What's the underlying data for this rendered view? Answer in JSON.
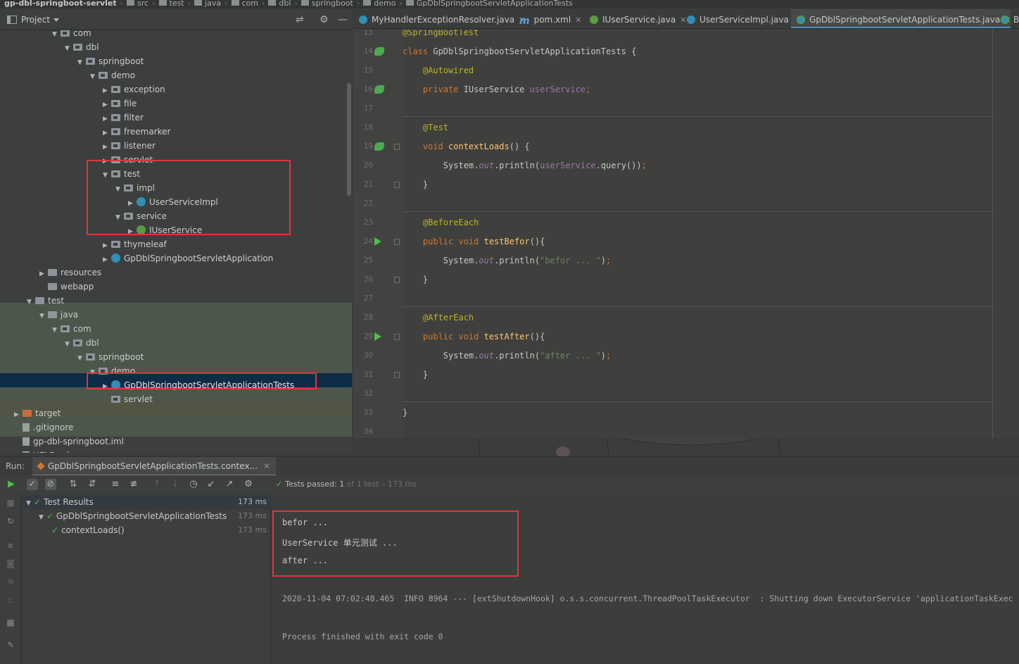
{
  "breadcrumb": [
    "gp-dbl-springboot-servlet",
    "src",
    "test",
    "java",
    "com",
    "dbl",
    "springboot",
    "demo",
    "GpDblSpringbootServletApplicationTests"
  ],
  "project_panel": {
    "title": "Project",
    "icons": [
      "collapse-icon",
      "gear-icon",
      "minimize-icon"
    ]
  },
  "tree": [
    {
      "label": "com",
      "depth": 5,
      "kind": "pkg",
      "arrow": "down"
    },
    {
      "label": "dbl",
      "depth": 6,
      "kind": "pkg",
      "arrow": "down"
    },
    {
      "label": "springboot",
      "depth": 7,
      "kind": "pkg",
      "arrow": "down"
    },
    {
      "label": "demo",
      "depth": 8,
      "kind": "pkg",
      "arrow": "down"
    },
    {
      "label": "exception",
      "depth": 9,
      "kind": "pkg",
      "arrow": "right"
    },
    {
      "label": "file",
      "depth": 9,
      "kind": "pkg",
      "arrow": "right"
    },
    {
      "label": "filter",
      "depth": 9,
      "kind": "pkg",
      "arrow": "right"
    },
    {
      "label": "freemarker",
      "depth": 9,
      "kind": "pkg",
      "arrow": "right"
    },
    {
      "label": "listener",
      "depth": 9,
      "kind": "pkg",
      "arrow": "right"
    },
    {
      "label": "servlet",
      "depth": 9,
      "kind": "pkg",
      "arrow": "right"
    },
    {
      "label": "test",
      "depth": 9,
      "kind": "pkg",
      "arrow": "down"
    },
    {
      "label": "impl",
      "depth": 10,
      "kind": "pkg",
      "arrow": "down"
    },
    {
      "label": "UserServiceImpl",
      "depth": 11,
      "kind": "class",
      "arrow": "right"
    },
    {
      "label": "service",
      "depth": 10,
      "kind": "pkg",
      "arrow": "down"
    },
    {
      "label": "IUserService",
      "depth": 11,
      "kind": "iface",
      "arrow": "right"
    },
    {
      "label": "thymeleaf",
      "depth": 9,
      "kind": "pkg",
      "arrow": "right"
    },
    {
      "label": "GpDblSpringbootServletApplication",
      "depth": 9,
      "kind": "class",
      "arrow": "right"
    },
    {
      "label": "resources",
      "depth": 4,
      "kind": "folder",
      "arrow": "right"
    },
    {
      "label": "webapp",
      "depth": 4,
      "kind": "folder",
      "arrow": ""
    },
    {
      "label": "test",
      "depth": 3,
      "kind": "folder",
      "arrow": "down"
    },
    {
      "label": "java",
      "depth": 4,
      "kind": "folder",
      "arrow": "down"
    },
    {
      "label": "com",
      "depth": 5,
      "kind": "pkg",
      "arrow": "down"
    },
    {
      "label": "dbl",
      "depth": 6,
      "kind": "pkg",
      "arrow": "down"
    },
    {
      "label": "springboot",
      "depth": 7,
      "kind": "pkg",
      "arrow": "down"
    },
    {
      "label": "demo",
      "depth": 8,
      "kind": "pkg",
      "arrow": "down"
    },
    {
      "label": "GpDblSpringbootServletApplicationTests",
      "depth": 9,
      "kind": "class",
      "arrow": "right"
    },
    {
      "label": "servlet",
      "depth": 9,
      "kind": "pkg",
      "arrow": ""
    },
    {
      "label": "target",
      "depth": 2,
      "kind": "orange",
      "arrow": "right"
    },
    {
      "label": ".gitignore",
      "depth": 2,
      "kind": "file",
      "arrow": ""
    },
    {
      "label": "gp-dbl-springboot.iml",
      "depth": 2,
      "kind": "file",
      "arrow": ""
    },
    {
      "label": "HELP.md",
      "depth": 2,
      "kind": "file",
      "arrow": ""
    }
  ],
  "editor_tabs": [
    {
      "label": "MyHandlerExceptionResolver.java",
      "icon": "class"
    },
    {
      "label": "pom.xml",
      "icon": "maven"
    },
    {
      "label": "IUserService.java",
      "icon": "iface"
    },
    {
      "label": "UserServiceImpl.java",
      "icon": "class"
    },
    {
      "label": "GpDblSpringbootServletApplicationTests.java",
      "icon": "test",
      "active": true
    },
    {
      "label": "Be",
      "icon": "test"
    }
  ],
  "code": [
    {
      "n": "13",
      "tokens": [
        [
          "ann",
          "@SpringBootTest"
        ]
      ]
    },
    {
      "n": "14",
      "tokens": [
        [
          "kw",
          "class "
        ],
        [
          "",
          "GpDblSpringbootServletApplicationTests {"
        ]
      ]
    },
    {
      "n": "15",
      "tokens": [
        [
          "",
          "    "
        ],
        [
          "ann",
          "@Autowired"
        ]
      ]
    },
    {
      "n": "16",
      "tokens": [
        [
          "",
          "    "
        ],
        [
          "kw",
          "private "
        ],
        [
          "",
          "IUserService "
        ],
        [
          "fld",
          "userService"
        ],
        [
          "kw",
          ";"
        ]
      ]
    },
    {
      "n": "17",
      "tokens": []
    },
    {
      "n": "18",
      "tokens": [
        [
          "",
          "    "
        ],
        [
          "ann",
          "@Test"
        ]
      ]
    },
    {
      "n": "19",
      "tokens": [
        [
          "",
          "    "
        ],
        [
          "kw",
          "void "
        ],
        [
          "mth",
          "contextLoads"
        ],
        [
          "",
          "() {"
        ]
      ]
    },
    {
      "n": "20",
      "tokens": [
        [
          "",
          "        System."
        ],
        [
          "stat",
          "out"
        ],
        [
          "",
          ".println("
        ],
        [
          "fld",
          "userService"
        ],
        [
          "",
          ".query())"
        ],
        [
          "kw",
          ";"
        ]
      ]
    },
    {
      "n": "21",
      "tokens": [
        [
          "",
          "    }"
        ]
      ]
    },
    {
      "n": "22",
      "tokens": []
    },
    {
      "n": "23",
      "tokens": [
        [
          "",
          "    "
        ],
        [
          "ann",
          "@BeforeEach"
        ]
      ]
    },
    {
      "n": "24",
      "tokens": [
        [
          "",
          "    "
        ],
        [
          "kw",
          "public void "
        ],
        [
          "mth",
          "testBefor"
        ],
        [
          "",
          "(){"
        ]
      ]
    },
    {
      "n": "25",
      "tokens": [
        [
          "",
          "        System."
        ],
        [
          "stat",
          "out"
        ],
        [
          "",
          ".println("
        ],
        [
          "str",
          "\"befor ... \""
        ],
        [
          "",
          ")"
        ],
        [
          "kw",
          ";"
        ]
      ]
    },
    {
      "n": "26",
      "tokens": [
        [
          "",
          "    }"
        ]
      ]
    },
    {
      "n": "27",
      "tokens": []
    },
    {
      "n": "28",
      "tokens": [
        [
          "",
          "    "
        ],
        [
          "ann",
          "@AfterEach"
        ]
      ]
    },
    {
      "n": "29",
      "tokens": [
        [
          "",
          "    "
        ],
        [
          "kw",
          "public void "
        ],
        [
          "mth",
          "testAfter"
        ],
        [
          "",
          "(){"
        ]
      ]
    },
    {
      "n": "30",
      "tokens": [
        [
          "",
          "        System."
        ],
        [
          "stat",
          "out"
        ],
        [
          "",
          ".println("
        ],
        [
          "str",
          "\"after ... \""
        ],
        [
          "",
          ")"
        ],
        [
          "kw",
          ";"
        ]
      ]
    },
    {
      "n": "31",
      "tokens": [
        [
          "",
          "    }"
        ]
      ]
    },
    {
      "n": "32",
      "tokens": []
    },
    {
      "n": "33",
      "tokens": [
        [
          "",
          "}"
        ]
      ]
    },
    {
      "n": "34",
      "tokens": []
    }
  ],
  "run": {
    "label": "Run:",
    "tab": "GpDblSpringbootServletApplicationTests.contex...",
    "tests_passed_label": "Tests passed:",
    "tests_passed_count": "1",
    "tests_passed_rest": "of 1 test – 173 ms"
  },
  "results": [
    {
      "label": "Test Results",
      "time": "173 ms",
      "depth": 0
    },
    {
      "label": "GpDblSpringbootServletApplicationTests",
      "time": "173 ms",
      "depth": 1
    },
    {
      "label": "contextLoads()",
      "time": "173 ms",
      "depth": 2
    }
  ],
  "console": [
    "befor ...",
    "UserService 单元测试 ...",
    "after ...",
    "",
    "2020-11-04 07:02:48.465  INFO 8964 --- [extShutdownHook] o.s.s.concurrent.ThreadPoolTaskExecutor  : Shutting down ExecutorService 'applicationTaskExec",
    "",
    "Process finished with exit code 0"
  ],
  "colors": {
    "accent": "#4a8fc7",
    "highlight_box": "#e0353a",
    "pass_green": "#4fbc4f"
  }
}
